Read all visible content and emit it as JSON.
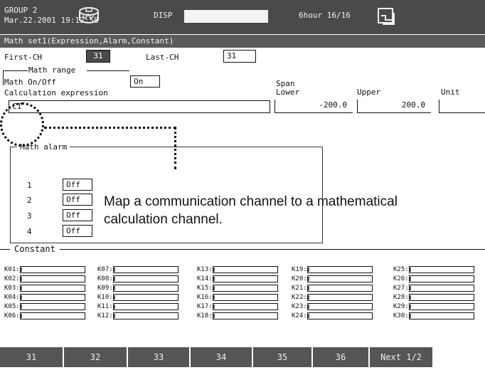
{
  "status": {
    "group": "GROUP 2",
    "datetime": "Mar.22.2001 19:12:58",
    "disp_label": "DISP",
    "span_label": "6hour 16/16"
  },
  "title": "Math set1(Expression,Alarm,Constant)",
  "channels": {
    "first_label": "First-CH",
    "first_value": "31",
    "last_label": "Last-CH",
    "last_value": "31"
  },
  "math_range": {
    "heading": "Math range",
    "onoff_label": "Math On/Off",
    "onoff_value": "On",
    "expression_label": "Calculation expression",
    "expression_value": "C1",
    "span_label": "Span",
    "lower_label": "Lower",
    "lower_value": "-200.0",
    "upper_label": "Upper",
    "upper_value": "200.0",
    "unit_label": "Unit",
    "unit_value": ""
  },
  "math_alarm": {
    "heading": "Math alarm",
    "rows": [
      {
        "num": "1",
        "value": "Off"
      },
      {
        "num": "2",
        "value": "Off"
      },
      {
        "num": "3",
        "value": "Off"
      },
      {
        "num": "4",
        "value": "Off"
      }
    ]
  },
  "annotation": {
    "line1": "Map a communication channel to a mathematical",
    "line2": "calculation channel."
  },
  "constant": {
    "heading": "Constant",
    "columns": [
      [
        "K01:",
        "K02:",
        "K03:",
        "K04:",
        "K05:",
        "K06:"
      ],
      [
        "K07:",
        "K08:",
        "K09:",
        "K10:",
        "K11:",
        "K12:"
      ],
      [
        "K13:",
        "K14:",
        "K15:",
        "K16:",
        "K17:",
        "K18:"
      ],
      [
        "K19:",
        "K20:",
        "K21:",
        "K22:",
        "K23:",
        "K24:"
      ],
      [
        "K25:",
        "K26:",
        "K27:",
        "K28:",
        "K29:",
        "K30:"
      ]
    ]
  },
  "softkeys": [
    "31",
    "32",
    "33",
    "34",
    "35",
    "36",
    "Next 1/2"
  ],
  "icons": {
    "disk": "disk-icon",
    "clipboard": "clipboard-icon"
  }
}
